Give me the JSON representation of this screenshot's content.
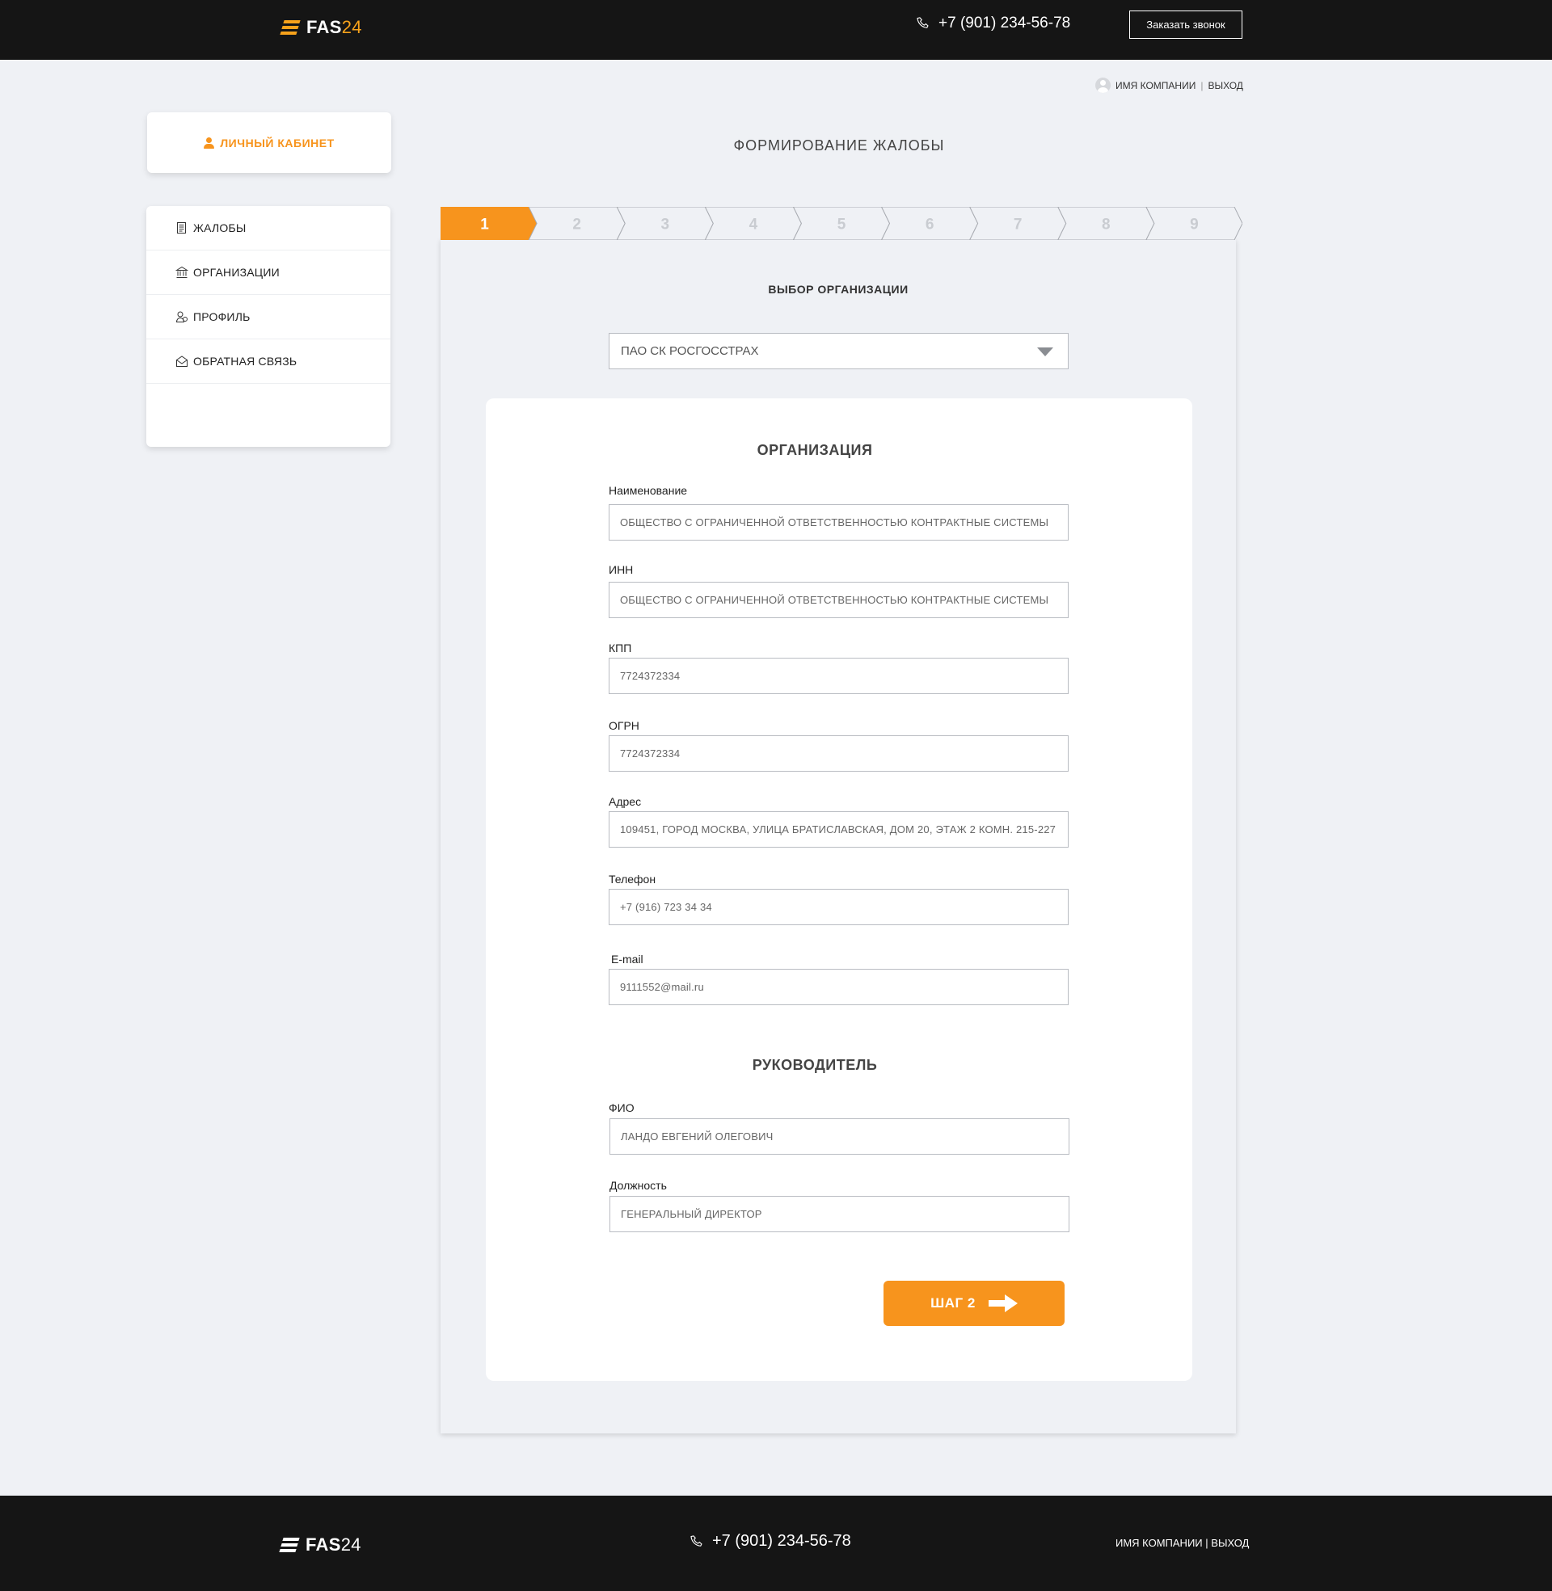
{
  "header": {
    "logo": {
      "bold": "FAS",
      "num": "24"
    },
    "phone": "+7 (901) 234-56-78",
    "callback_label": "Заказать звонок"
  },
  "user": {
    "company": "ИМЯ КОМПАНИИ",
    "sep": "|",
    "logout": "ВЫХОД"
  },
  "sidebar": {
    "cabinet_label": "ЛИЧНЫЙ КАБИНЕТ",
    "items": [
      {
        "label": "ЖАЛОБЫ",
        "icon": "document-icon"
      },
      {
        "label": "ОРГАНИЗАЦИИ",
        "icon": "bank-icon"
      },
      {
        "label": "ПРОФИЛЬ",
        "icon": "profile-icon"
      },
      {
        "label": "ОБРАТНАЯ СВЯЗЬ",
        "icon": "envelope-icon"
      }
    ]
  },
  "main": {
    "title": "ФОРМИРОВАНИЕ ЖАЛОБЫ",
    "steps": [
      "1",
      "2",
      "3",
      "4",
      "5",
      "6",
      "7",
      "8",
      "9"
    ],
    "active_step": 1,
    "subtitle": "ВЫБОР ОРГАНИЗАЦИИ",
    "org_select_value": "ПАО СК РОСГОССТРАХ",
    "org_section_title": "ОРГАНИЗАЦИЯ",
    "fields": {
      "name": {
        "label": "Наименование",
        "value": "ОБЩЕСТВО С ОГРАНИЧЕННОЙ ОТВЕТСТВЕННОСТЬЮ КОНТРАКТНЫЕ СИСТЕМЫ"
      },
      "inn": {
        "label": "ИНН",
        "value": "ОБЩЕСТВО С ОГРАНИЧЕННОЙ ОТВЕТСТВЕННОСТЬЮ КОНТРАКТНЫЕ СИСТЕМЫ"
      },
      "kpp": {
        "label": "КПП",
        "value": "7724372334"
      },
      "ogrn": {
        "label": "ОГРН",
        "value": "7724372334"
      },
      "address": {
        "label": "Адрес",
        "value": "109451, ГОРОД МОСКВА, УЛИЦА БРАТИСЛАВСКАЯ, ДОМ 20, ЭТАЖ 2 КОМН. 215-227"
      },
      "phone": {
        "label": "Телефон",
        "value": "+7 (916) 723 34 34"
      },
      "email": {
        "label": "E-mail",
        "value": "9111552@mail.ru"
      }
    },
    "head_section_title": "РУКОВОДИТЕЛЬ",
    "head_fields": {
      "fio": {
        "label": "ФИО",
        "value": "ЛАНДО ЕВГЕНИЙ ОЛЕГОВИЧ"
      },
      "position": {
        "label": "Должность",
        "value": "ГЕНЕРАЛЬНЫЙ ДИРЕКТОР"
      }
    },
    "next_label": "ШАГ 2"
  },
  "colors": {
    "accent": "#f7941d",
    "header_bg": "#151515",
    "page_bg": "#eff1f5"
  }
}
